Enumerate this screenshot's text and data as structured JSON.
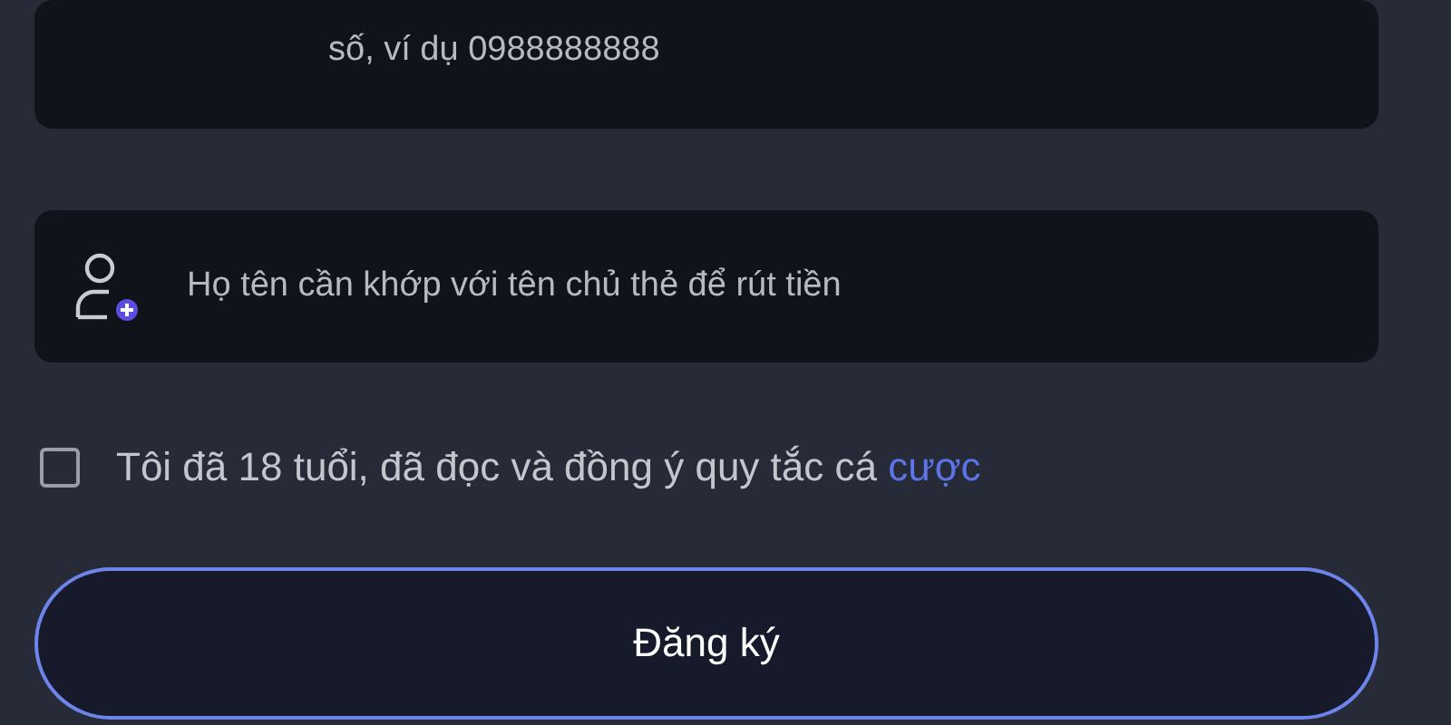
{
  "fields": [
    {
      "kind": "phone",
      "placeholder": "số, ví dụ 0988888888"
    },
    {
      "kind": "name",
      "placeholder": "Họ tên cần khớp với tên chủ thẻ để rút tiền"
    }
  ],
  "agreement": {
    "checked": false,
    "text": "Tôi đã 18 tuổi, đã đọc và đồng ý quy tắc cá",
    "link": "cược"
  },
  "submit": {
    "label": "Đăng ký"
  }
}
